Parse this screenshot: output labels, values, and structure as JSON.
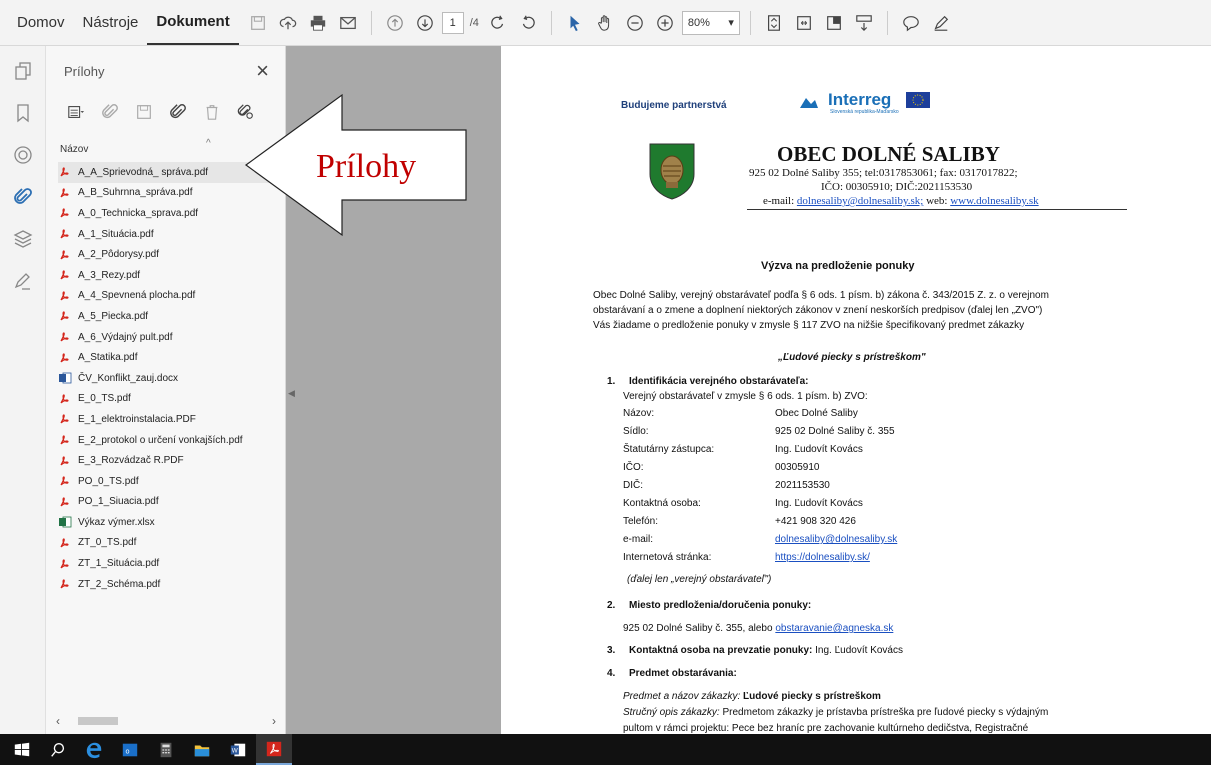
{
  "menu": {
    "home": "Domov",
    "tools": "Nástroje",
    "document": "Dokument"
  },
  "toolbar": {
    "page_current": "1",
    "page_total": "/4",
    "zoom": "80%"
  },
  "panel": {
    "title": "Prílohy",
    "close": "×",
    "column_header": "Názov",
    "files": [
      {
        "name": "A_A_Sprievodná_ správa.pdf",
        "type": "pdf"
      },
      {
        "name": "A_B_Suhrnna_správa.pdf",
        "type": "pdf"
      },
      {
        "name": "A_0_Technicka_sprava.pdf",
        "type": "pdf"
      },
      {
        "name": "A_1_Situácia.pdf",
        "type": "pdf"
      },
      {
        "name": "A_2_Pôdorysy.pdf",
        "type": "pdf"
      },
      {
        "name": "A_3_Rezy.pdf",
        "type": "pdf"
      },
      {
        "name": "A_4_Spevnená plocha.pdf",
        "type": "pdf"
      },
      {
        "name": "A_5_Piecka.pdf",
        "type": "pdf"
      },
      {
        "name": "A_6_Výdajný pult.pdf",
        "type": "pdf"
      },
      {
        "name": "A_Statika.pdf",
        "type": "pdf"
      },
      {
        "name": "ČV_Konflikt_zauj.docx",
        "type": "docx"
      },
      {
        "name": "E_0_TS.pdf",
        "type": "pdf"
      },
      {
        "name": "E_1_elektroinstalacia.PDF",
        "type": "pdf"
      },
      {
        "name": "E_2_protokol o určení vonkajších.pdf",
        "type": "pdf"
      },
      {
        "name": "E_3_Rozvádzač R.PDF",
        "type": "pdf"
      },
      {
        "name": "PO_0_TS.pdf",
        "type": "pdf"
      },
      {
        "name": "PO_1_Siuacia.pdf",
        "type": "pdf"
      },
      {
        "name": "Výkaz výmer.xlsx",
        "type": "xlsx"
      },
      {
        "name": "ZT_0_TS.pdf",
        "type": "pdf"
      },
      {
        "name": "ZT_1_Situácia.pdf",
        "type": "pdf"
      },
      {
        "name": "ZT_2_Schéma.pdf",
        "type": "pdf"
      }
    ]
  },
  "callout": {
    "label": "Prílohy"
  },
  "document": {
    "tagline": "Budujeme partnerstvá",
    "interreg_logo": "Interreg",
    "interreg_sub": "Slovenská republika-Maďarsko",
    "heading": "OBEC DOLNÉ   SALIBY",
    "address": "925 02 Dolné Saliby 355; tel:0317853061; fax: 0317017822;",
    "ids": "IČO: 00305910;  DIČ:2021153530",
    "contact_prefix": "e-mail: ",
    "contact_email": "dolnesaliby@dolnesaliby.sk;",
    "contact_mid": " web: ",
    "contact_web": "www.dolnesaliby.sk",
    "title": "Výzva na predloženie ponuky",
    "intro": [
      "Obec Dolné Saliby, verejný obstarávateľ podľa § 6 ods. 1 písm. b) zákona č. 343/2015 Z. z. o verejnom",
      "obstarávaní a o zmene a doplnení niektorých zákonov v znení neskorších predpisov (ďalej len „ZVO\")",
      "Vás žiadame o predloženie ponuky v zmysle § 117 ZVO na nižšie špecifikovaný predmet zákazky"
    ],
    "subject": "„Ľudové piecky s prístreškom\"",
    "s1_num": "1.",
    "s1_title": "Identifikácia verejného obstarávateľa:",
    "s1_line": "Verejný obstarávateľ v zmysle § 6 ods. 1 písm. b) ZVO:",
    "s1_rows": [
      {
        "label": "Názov:",
        "value": "Obec Dolné Saliby"
      },
      {
        "label": "Sídlo:",
        "value": "925 02 Dolné Saliby č. 355"
      },
      {
        "label": "Štatutárny zástupca:",
        "value": "Ing. Ľudovít Kovács"
      },
      {
        "label": "IČO:",
        "value": "00305910"
      },
      {
        "label": "DIČ:",
        "value": "2021153530"
      },
      {
        "label": "Kontaktná osoba:",
        "value": "Ing. Ľudovít Kovács"
      },
      {
        "label": "Telefón:",
        "value": "+421 908 320 426"
      },
      {
        "label": "e-mail:",
        "value": "dolnesaliby@dolnesaliby.sk"
      },
      {
        "label": "Internetová stránka:",
        "value": "https://dolnesaliby.sk/"
      }
    ],
    "s1_note": "(ďalej len „verejný obstarávateľ\")",
    "s2_num": "2.",
    "s2_title": "Miesto predloženia/doručenia ponuky:",
    "s2_line_prefix": "925 02 Dolné Saliby č. 355, alebo ",
    "s2_email": "obstaravanie@agneska.sk",
    "s3_num": "3.",
    "s3_title": "Kontaktná osoba na prevzatie ponuky:",
    "s3_value": " Ing. Ľudovít Kovács",
    "s4_num": "4.",
    "s4_title": "Predmet obstarávania:",
    "s4_l1_label": "Predmet a názov zákazky:",
    "s4_l1_value": " Ľudové piecky s prístreškom",
    "s4_l2_label": "Stručný opis zákazky:",
    "s4_l2_value": " Predmetom zákazky je prístavba prístreška pre ľudové piecky s výdajným",
    "s4_l3": "pultom v rámci projektu: Pece bez hraníc pre zachovanie kultúrneho dedičstva, Registračné"
  }
}
